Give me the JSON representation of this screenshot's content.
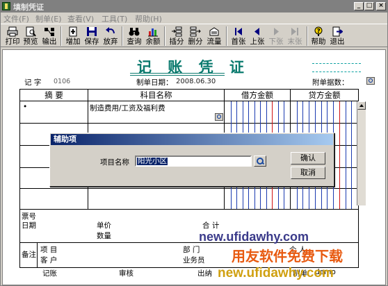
{
  "window": {
    "title": "填制凭证",
    "controls": [
      "_",
      "□",
      "×"
    ]
  },
  "menu": [
    "文件(F)",
    "制单(E)",
    "查看(V)",
    "工具(T)",
    "帮助(H)"
  ],
  "toolbar": [
    {
      "label": "打印",
      "icon": "printer-icon"
    },
    {
      "label": "预览",
      "icon": "preview-icon"
    },
    {
      "label": "输出",
      "icon": "output-icon"
    },
    {
      "label": "增加",
      "icon": "add-icon"
    },
    {
      "label": "保存",
      "icon": "save-icon"
    },
    {
      "label": "放弃",
      "icon": "undo-icon"
    },
    {
      "label": "查询",
      "icon": "binoculars-icon"
    },
    {
      "label": "余额",
      "icon": "balance-chart-icon"
    },
    {
      "label": "插分",
      "icon": "insert-entry-icon"
    },
    {
      "label": "删分",
      "icon": "delete-entry-icon"
    },
    {
      "label": "流量",
      "icon": "cashflow-icon"
    },
    {
      "label": "首张",
      "icon": "first-icon"
    },
    {
      "label": "上张",
      "icon": "prev-icon"
    },
    {
      "label": "下张",
      "icon": "next-icon"
    },
    {
      "label": "末张",
      "icon": "last-icon"
    },
    {
      "label": "帮助",
      "icon": "help-icon"
    },
    {
      "label": "退出",
      "icon": "exit-icon"
    }
  ],
  "voucher": {
    "title": "记 账 凭 证",
    "type_label": "记  字",
    "number": "0106",
    "date_label": "制单日期：",
    "date": "2008.06.30",
    "attach_label": "附单据数：",
    "columns": [
      "摘  要",
      "科目名称",
      "借方金额",
      "贷方金额"
    ],
    "row1_summary": "•",
    "row1_account": "制造费用/工资及福利费",
    "footer": {
      "ticket_no": "票号",
      "date": "日期",
      "unit_price": "单价",
      "quantity": "数量",
      "total": "合  计",
      "note": "备注",
      "project": "项  目",
      "customer": "客  户",
      "department": "部  门",
      "salesperson": "业务员",
      "personal": "个  人"
    },
    "signatures": [
      "记账",
      "审核",
      "出纳",
      "制单"
    ],
    "maker_name": "demo"
  },
  "dialog": {
    "title": "辅助项",
    "field_label": "项目名称",
    "field_value": "阳光小区",
    "ok": "确认",
    "cancel": "取消"
  },
  "watermarks": {
    "url1": "new.ufidawhy.com",
    "slogan": "用友软件免费下载",
    "url2": "new.ufidawhy.com"
  }
}
